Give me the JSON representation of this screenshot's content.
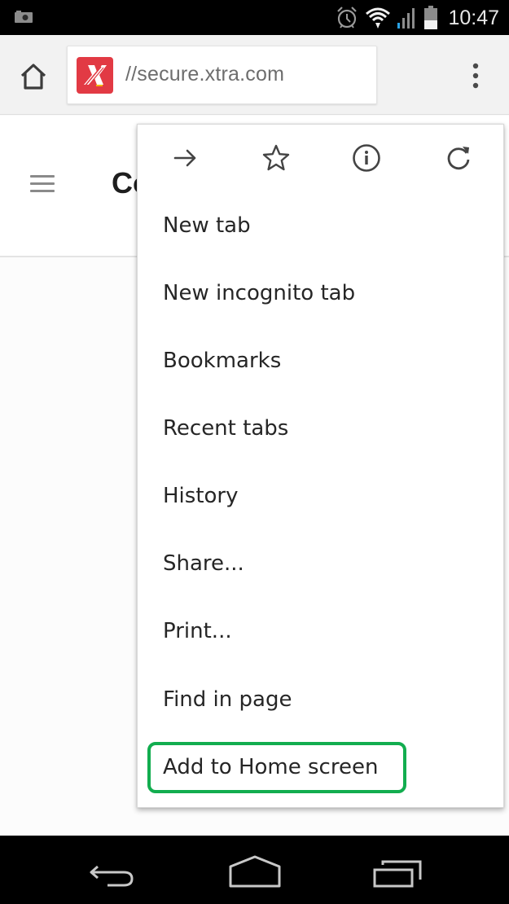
{
  "status_bar": {
    "time": "10:47",
    "icons": [
      "screenshot-notification-icon",
      "alarm-icon",
      "wifi-icon",
      "cell-signal-icon",
      "battery-icon"
    ],
    "signal_accent": "#2aa3e6"
  },
  "toolbar": {
    "home_icon": "home-icon",
    "url": "//secure.xtra.com",
    "favicon": "xtra-logo-icon",
    "favicon_color": "#e23a44",
    "overflow_icon": "more-vert-icon"
  },
  "page": {
    "title": "Co",
    "menu_icon": "hamburger-icon"
  },
  "menu": {
    "top_icons": [
      {
        "name": "forward-icon",
        "label": "Forward"
      },
      {
        "name": "bookmark-star-icon",
        "label": "Bookmark"
      },
      {
        "name": "page-info-icon",
        "label": "Page info"
      },
      {
        "name": "reload-icon",
        "label": "Reload"
      }
    ],
    "items": [
      {
        "label": "New tab"
      },
      {
        "label": "New incognito tab"
      },
      {
        "label": "Bookmarks"
      },
      {
        "label": "Recent tabs"
      },
      {
        "label": "History"
      },
      {
        "label": "Share..."
      },
      {
        "label": "Print..."
      },
      {
        "label": "Find in page"
      },
      {
        "label": "Add to Home screen"
      }
    ],
    "highlighted_item": "Add to Home screen",
    "highlight_color": "#12ad4f"
  },
  "nav_bar": {
    "buttons": [
      "back-icon",
      "home-icon",
      "recent-apps-icon"
    ]
  }
}
